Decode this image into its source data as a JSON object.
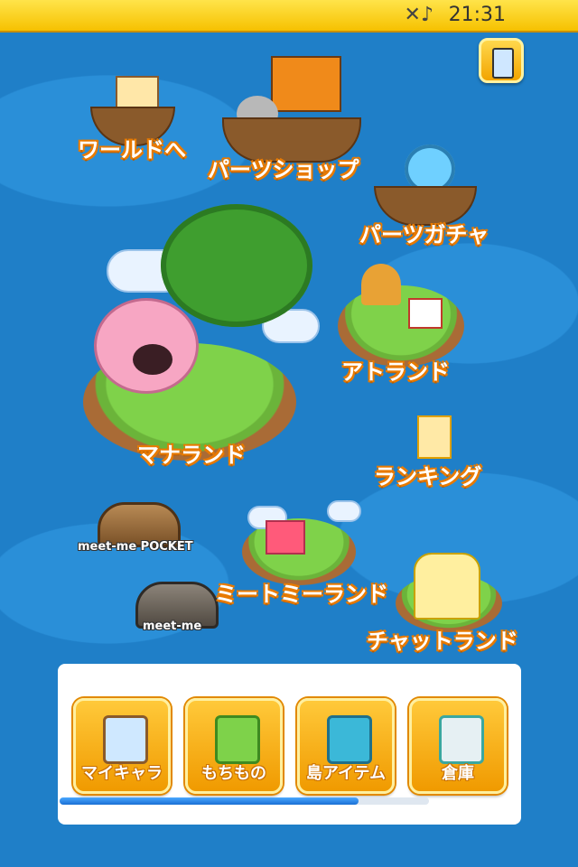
{
  "status_bar": {
    "time": "21:31",
    "icon": "muted-music-icon"
  },
  "header": {
    "phone_button_icon": "phone-icon"
  },
  "map": {
    "world": "ワールドへ",
    "parts_shop": "パーツショップ",
    "parts_gacha": "パーツガチャ",
    "manaland": "マナランド",
    "atland": "アトランド",
    "ranking": "ランキング",
    "meetme_pocket": "meet-me POCKET",
    "meetme": "meet-me",
    "meetme_land": "ミートミーランド",
    "chat_land": "チャットランド"
  },
  "bottom_menu": {
    "buttons": [
      {
        "label": "マイキャラ",
        "icon": "character-card-icon"
      },
      {
        "label": "もちもの",
        "icon": "bag-icon"
      },
      {
        "label": "島アイテム",
        "icon": "suitcase-icon"
      },
      {
        "label": "倉庫",
        "icon": "warehouse-icon"
      }
    ],
    "progress": 0.81
  },
  "colors": {
    "accent": "#f5a300",
    "sea": "#1f7fc8",
    "label_outline": "#e87a00"
  }
}
